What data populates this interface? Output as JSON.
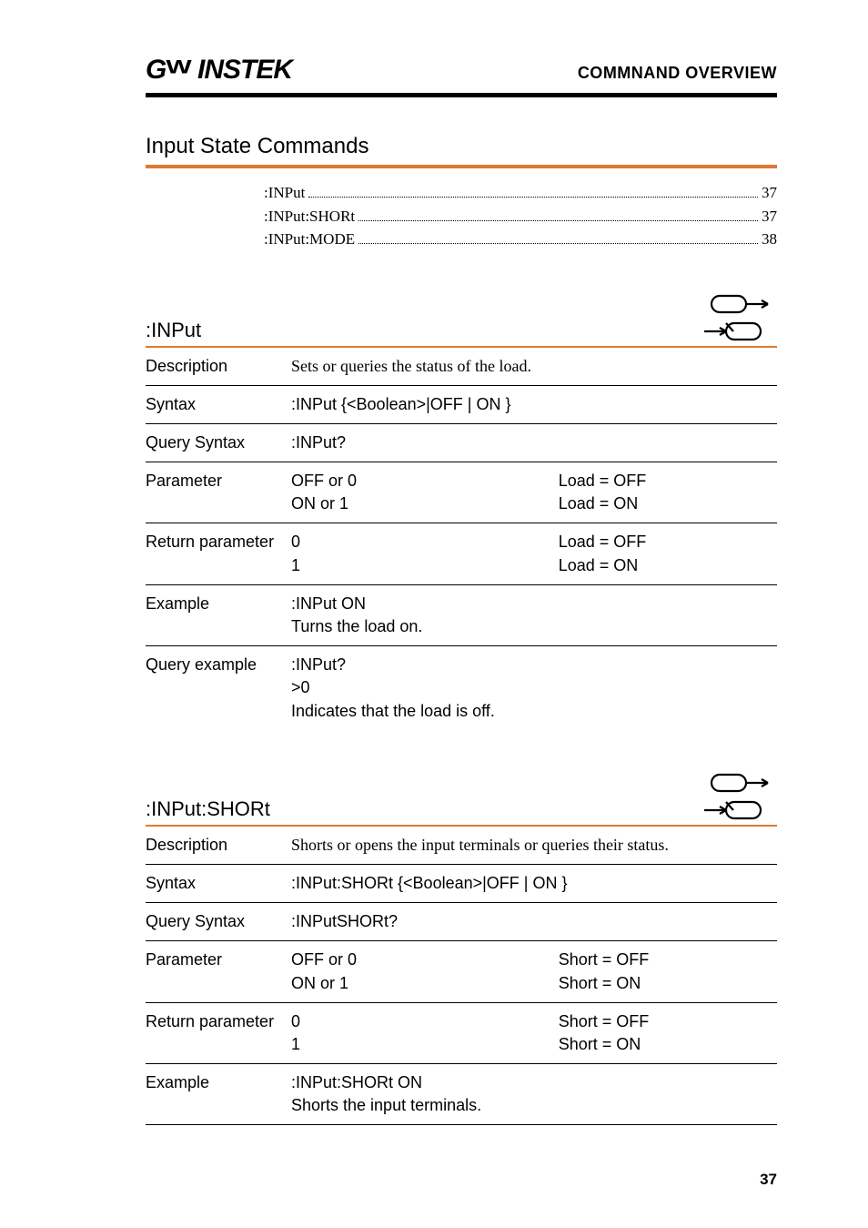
{
  "header": {
    "logo": "GWINSTEK",
    "title": "COMMNAND OVERVIEW"
  },
  "section_title": "Input State Commands",
  "toc": [
    {
      "label": ":INPut",
      "page": "37"
    },
    {
      "label": ":INPut:SHORt",
      "page": "37"
    },
    {
      "label": ":INPut:MODE",
      "page": "38"
    }
  ],
  "commands": [
    {
      "name": ":INPut",
      "rows": [
        {
          "label": "Description",
          "serif": true,
          "lines": [
            "Sets or queries the status of the load."
          ],
          "rule": "thin"
        },
        {
          "label": "Syntax",
          "lines": [
            ":INPut {<Boolean>|OFF | ON }"
          ],
          "rule": "thin"
        },
        {
          "label": "Query Syntax",
          "lines": [
            ":INPut?"
          ],
          "rule": "thin"
        },
        {
          "label": "Parameter",
          "twocol": [
            [
              "OFF or 0",
              "Load  = OFF"
            ],
            [
              "ON or 1",
              "Load = ON"
            ]
          ],
          "rule": "thin"
        },
        {
          "label": "Return parameter",
          "twocol": [
            [
              "0",
              "Load = OFF"
            ],
            [
              "1",
              "Load = ON"
            ]
          ],
          "rule": "thin"
        },
        {
          "label": "Example",
          "lines": [
            ":INPut ON",
            "Turns the load on."
          ],
          "rule": "thin"
        },
        {
          "label": "Query example",
          "lines": [
            ":INPut?",
            ">0",
            "Indicates that the load is off."
          ],
          "rule": null
        }
      ]
    },
    {
      "name": ":INPut:SHORt",
      "rows": [
        {
          "label": "Description",
          "serif": true,
          "lines": [
            "Shorts or opens the input terminals or queries their status."
          ],
          "rule": "thin"
        },
        {
          "label": "Syntax",
          "lines": [
            ":INPut:SHORt {<Boolean>|OFF | ON }"
          ],
          "rule": "thin"
        },
        {
          "label": "Query Syntax",
          "lines": [
            ":INPutSHORt?"
          ],
          "rule": "thin"
        },
        {
          "label": "Parameter",
          "twocol": [
            [
              "OFF or 0",
              "Short  = OFF"
            ],
            [
              "ON or 1",
              "Short = ON"
            ]
          ],
          "rule": "thin"
        },
        {
          "label": "Return parameter",
          "twocol": [
            [
              "0",
              "Short  = OFF"
            ],
            [
              "1",
              "Short = ON"
            ]
          ],
          "rule": "thin"
        },
        {
          "label": "Example",
          "lines": [
            ":INPut:SHORt ON",
            "Shorts the input terminals."
          ],
          "rule": "thin"
        }
      ]
    }
  ],
  "page_number": "37"
}
